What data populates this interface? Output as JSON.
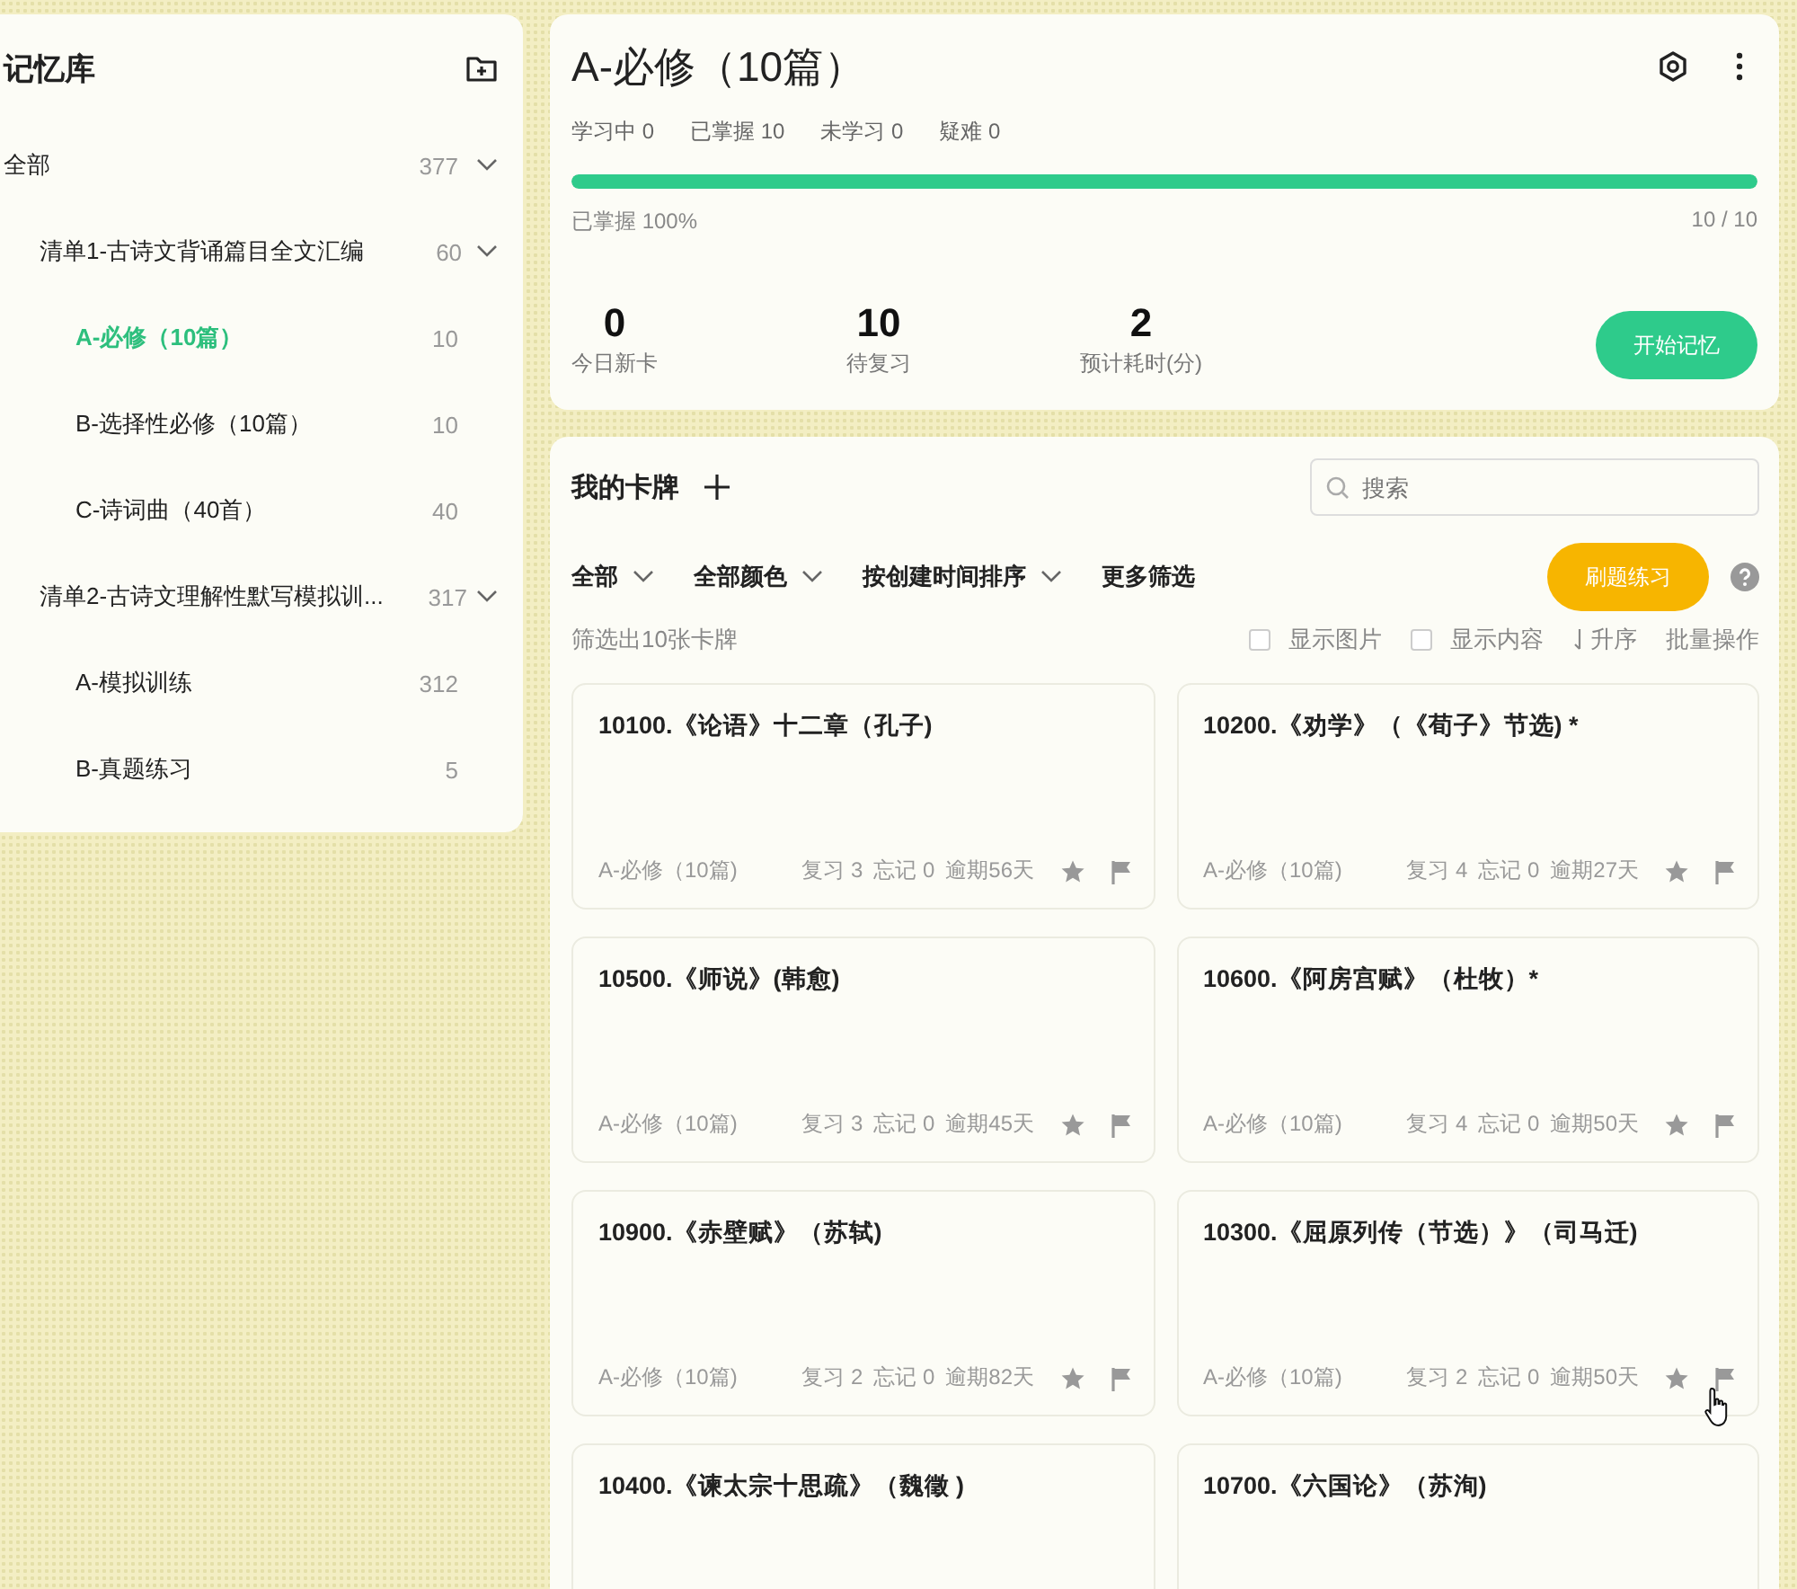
{
  "sidebar": {
    "title": "记忆库",
    "tree": [
      {
        "label": "全部",
        "count": "377",
        "expanded": true,
        "selected": false,
        "children": [
          {
            "label": "清单1-古诗文背诵篇目全文汇编",
            "count": "60",
            "expanded": true,
            "selected": false,
            "children": [
              {
                "label": "A-必修（10篇）",
                "count": "10",
                "selected": true
              },
              {
                "label": "B-选择性必修（10篇）",
                "count": "10",
                "selected": false
              },
              {
                "label": "C-诗词曲（40首）",
                "count": "40",
                "selected": false
              }
            ]
          },
          {
            "label": "清单2-古诗文理解性默写模拟训...",
            "count": "317",
            "expanded": true,
            "selected": false,
            "children": [
              {
                "label": "A-模拟训练",
                "count": "312",
                "selected": false
              },
              {
                "label": "B-真题练习",
                "count": "5",
                "selected": false
              }
            ]
          }
        ]
      }
    ]
  },
  "deck": {
    "title": "A-必修（10篇）",
    "stats": [
      "学习中 0",
      "已掌握 10",
      "未学习 0",
      "疑难 0"
    ],
    "progress": {
      "level": 1,
      "caption": "已掌握 100%",
      "ratio": "10 / 10"
    },
    "metrics": [
      {
        "value": "0",
        "label": "今日新卡"
      },
      {
        "value": "10",
        "label": "待复习"
      },
      {
        "value": "2",
        "label": "预计耗时(分)"
      }
    ],
    "start_button": "开始记忆"
  },
  "cards_panel": {
    "title": "我的卡牌",
    "search": {
      "placeholder": "搜索"
    },
    "filters": [
      {
        "label": "全部",
        "dropdown": true
      },
      {
        "label": "全部颜色",
        "dropdown": true
      },
      {
        "label": "按创建时间排序",
        "dropdown": true
      },
      {
        "label": "更多筛选",
        "dropdown": false
      }
    ],
    "practice_button": "刷题练习",
    "result_count": "筛选出10张卡牌",
    "options": [
      {
        "label": "显示图片",
        "checked": false
      },
      {
        "label": "显示内容",
        "checked": false
      }
    ],
    "sort": "升序",
    "batch": "批量操作",
    "cards": [
      {
        "title": "10100.《论语》十二章（孔子)",
        "deck": "A-必修（10篇)",
        "review": "复习 3",
        "forget": "忘记 0",
        "overdue": "逾期56天",
        "hover": false
      },
      {
        "title": "10200.《劝学》（《荀子》节选) *",
        "deck": "A-必修（10篇)",
        "review": "复习 4",
        "forget": "忘记 0",
        "overdue": "逾期27天",
        "hover": false
      },
      {
        "title": "10500.《师说》(韩愈)",
        "deck": "A-必修（10篇)",
        "review": "复习 3",
        "forget": "忘记 0",
        "overdue": "逾期45天",
        "hover": false
      },
      {
        "title": "10600.《阿房宫赋》（杜牧）*",
        "deck": "A-必修（10篇)",
        "review": "复习 4",
        "forget": "忘记 0",
        "overdue": "逾期50天",
        "hover": false
      },
      {
        "title": "10900.《赤壁赋》（苏轼)",
        "deck": "A-必修（10篇)",
        "review": "复习 2",
        "forget": "忘记 0",
        "overdue": "逾期82天",
        "hover": false
      },
      {
        "title": "10300.《屈原列传（节选）》（司马迁)",
        "deck": "A-必修（10篇)",
        "review": "复习 2",
        "forget": "忘记 0",
        "overdue": "逾期50天",
        "hover": true
      },
      {
        "title": "10400.《谏太宗十思疏》（魏徵 )"
      },
      {
        "title": "10700.《六国论》（苏洵)"
      }
    ]
  }
}
